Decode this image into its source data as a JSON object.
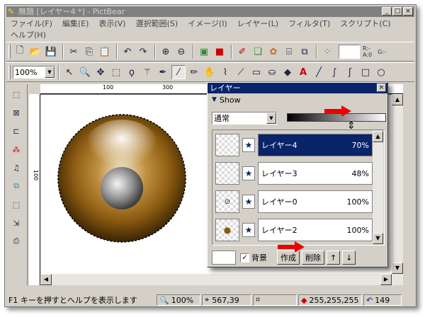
{
  "window": {
    "title": "無題 [レイヤー4 *] - PictBear",
    "btn_min": "_",
    "btn_max": "□",
    "btn_close": "×"
  },
  "menu": [
    "ファイル(F)",
    "編集(E)",
    "表示(V)",
    "選択範囲(S)",
    "イメージ(I)",
    "レイヤー(L)",
    "フィルタ(T)",
    "スクリプト(C)",
    "ヘルプ(H)"
  ],
  "toolbar1": {
    "icons": [
      "new-icon",
      "open-icon",
      "save-icon",
      "cut-icon",
      "copy-icon",
      "paste-icon",
      "undo-icon",
      "redo-icon",
      "zoom-in-icon",
      "zoom-out-icon",
      "image-icon",
      "color-icon",
      "brush-icon",
      "layers-icon",
      "palette-icon",
      "stamp-icon",
      "photo-icon",
      "grid-icon"
    ],
    "coord_r": "R:-",
    "coord_a": "A:0",
    "coord_g": "G:-"
  },
  "toolbar2": {
    "zoom": "100%",
    "tools": [
      "arrow-icon",
      "zoom-icon",
      "move-icon",
      "rect-select-icon",
      "lasso-icon",
      "magic-wand-icon",
      "pen-icon",
      "brush-tool-icon",
      "pencil-icon",
      "hand-icon",
      "airbrush-icon",
      "eyedropper-icon",
      "eraser-icon",
      "bucket-icon",
      "fill-icon",
      "text-icon",
      "line-icon",
      "curve-icon",
      "bezier-icon",
      "rect-icon",
      "ellipse-icon"
    ]
  },
  "ruler": {
    "h_labels": [
      "100",
      "300"
    ],
    "v_label": "100"
  },
  "status": {
    "help": "F1 キーを押すとヘルプを表示します",
    "zoom": "100%",
    "coords": "567,39",
    "color": "255,255,255",
    "history": "149"
  },
  "layer_panel": {
    "title": "レイヤー",
    "show": "Show",
    "blend_mode": "通常",
    "layers": [
      {
        "name": "レイヤー4",
        "opacity": "70%",
        "selected": true
      },
      {
        "name": "レイヤー3",
        "opacity": "48%",
        "selected": false
      },
      {
        "name": "レイヤー0",
        "opacity": "100%",
        "selected": false
      },
      {
        "name": "レイヤー2",
        "opacity": "100%",
        "selected": false
      }
    ],
    "background_label": "背景",
    "background_checked": "✓",
    "btn_create": "作成",
    "btn_delete": "削除",
    "btn_up": "↑",
    "btn_down": "↓",
    "close": "×"
  }
}
